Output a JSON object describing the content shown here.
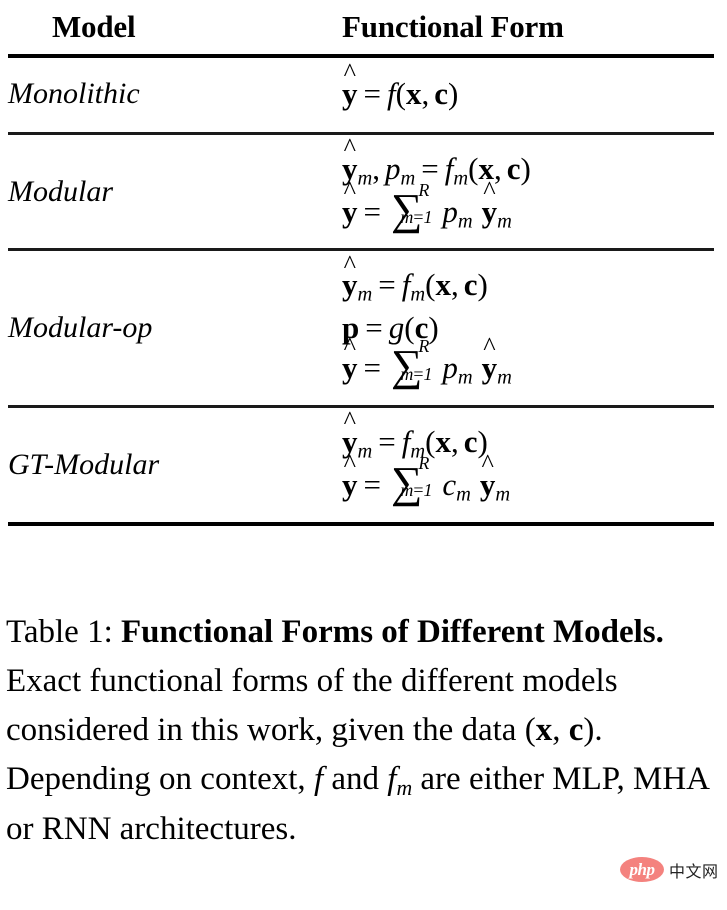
{
  "table": {
    "columns": [
      {
        "key": "model",
        "header": "Model"
      },
      {
        "key": "form",
        "header": "Functional Form"
      }
    ],
    "rows": [
      {
        "model": "Monolithic",
        "equations": [
          {
            "latex": "\\hat{\\mathbf{y}} = f(\\mathbf{x}, \\mathbf{c})",
            "plain": "ŷ = f(x, c)"
          }
        ]
      },
      {
        "model": "Modular",
        "equations": [
          {
            "latex": "\\hat{\\mathbf{y}}_m, p_m = f_m(\\mathbf{x}, \\mathbf{c})",
            "plain": "ŷ_m, p_m = f_m(x, c)"
          },
          {
            "latex": "\\hat{\\mathbf{y}} = \\sum_{m=1}^{R} p_m \\hat{\\mathbf{y}}_m",
            "plain": "ŷ = Σ_{m=1}^{R} p_m ŷ_m"
          }
        ]
      },
      {
        "model": "Modular-op",
        "equations": [
          {
            "latex": "\\hat{\\mathbf{y}}_m = f_m(\\mathbf{x}, \\mathbf{c})",
            "plain": "ŷ_m = f_m(x, c)"
          },
          {
            "latex": "\\mathbf{p} = g(\\mathbf{c})",
            "plain": "p = g(c)"
          },
          {
            "latex": "\\hat{\\mathbf{y}} = \\sum_{m=1}^{R} p_m \\hat{\\mathbf{y}}_m",
            "plain": "ŷ = Σ_{m=1}^{R} p_m ŷ_m"
          }
        ]
      },
      {
        "model": "GT-Modular",
        "equations": [
          {
            "latex": "\\hat{\\mathbf{y}}_m = f_m(\\mathbf{x}, \\mathbf{c})",
            "plain": "ŷ_m = f_m(x, c)"
          },
          {
            "latex": "\\hat{\\mathbf{y}} = \\sum_{m=1}^{R} c_m \\hat{\\mathbf{y}}_m",
            "plain": "ŷ = Σ_{m=1}^{R} c_m ŷ_m"
          }
        ]
      }
    ],
    "symbols": {
      "hat": "^",
      "sigma": "∑",
      "equals": "=",
      "comma": ",",
      "paren_open": "(",
      "paren_close": ")",
      "y": "y",
      "x": "x",
      "c": "c",
      "p": "p",
      "f": "f",
      "g": "g",
      "sub_m": "m",
      "lim_upper": "R",
      "lim_lower": "m=1"
    }
  },
  "caption": {
    "label": "Table 1:",
    "title": "Functional Forms of Different Models.",
    "body_1": " Exact functional forms of the different models considered in this work, given the data (",
    "body_x": "x",
    "body_comma": ", ",
    "body_c": "c",
    "body_2": "). Depending on context, ",
    "body_f": "f",
    "body_3": " and ",
    "body_fm": "f",
    "body_fm_sub": "m",
    "body_4": " are either MLP, MHA or RNN architectures."
  },
  "watermark": {
    "badge_text": "php",
    "site_text": "中文网",
    "badge_color": "#f4827e"
  }
}
